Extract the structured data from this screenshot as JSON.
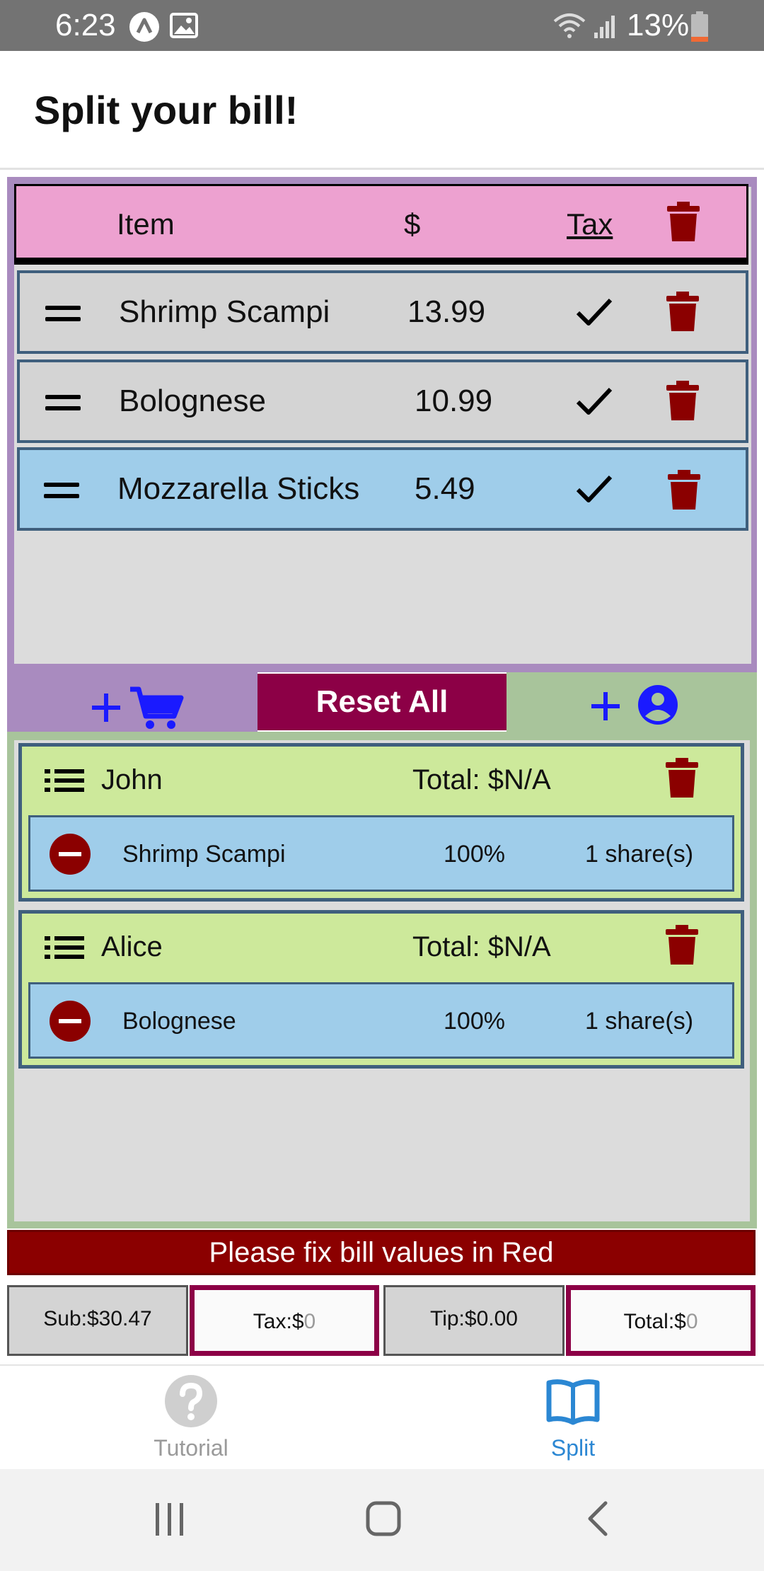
{
  "status_bar": {
    "time": "6:23",
    "battery": "13%"
  },
  "header": {
    "title": "Split your bill!"
  },
  "items_table": {
    "header": {
      "item": "Item",
      "price": "$",
      "tax": "Tax"
    },
    "rows": [
      {
        "name": "Shrimp Scampi",
        "price": "13.99",
        "taxed": true,
        "bg": "#d4d4d4"
      },
      {
        "name": "Bolognese",
        "price": "10.99",
        "taxed": true,
        "bg": "#d4d4d4"
      },
      {
        "name": "Mozzarella Sticks",
        "price": "5.49",
        "taxed": true,
        "bg": "#9fcdea"
      }
    ]
  },
  "toolbar": {
    "reset_label": "Reset All"
  },
  "people": [
    {
      "name": "John",
      "total": "Total: $N/A",
      "assignments": [
        {
          "item": "Shrimp Scampi",
          "percent": "100%",
          "shares": "1 share(s)"
        }
      ]
    },
    {
      "name": "Alice",
      "total": "Total: $N/A",
      "assignments": [
        {
          "item": "Bolognese",
          "percent": "100%",
          "shares": "1 share(s)"
        }
      ]
    }
  ],
  "error_banner": "Please fix bill values in Red",
  "totals": {
    "sub": "Sub:$30.47",
    "tax_label": "Tax:$",
    "tax_value": "0",
    "tip": "Tip:$0.00",
    "total_label": "Total:$",
    "total_value": "0"
  },
  "bottom_nav": {
    "tutorial": "Tutorial",
    "split": "Split"
  },
  "colors": {
    "header_pink": "#eda1d0",
    "items_purple": "#a98bbf",
    "people_green": "#a8c49b",
    "reset_maroon": "#8c0046",
    "error_red": "#8b0000",
    "trash_red": "#8b0000",
    "accent_blue": "#1a4bff",
    "nav_active": "#2b87d3"
  }
}
